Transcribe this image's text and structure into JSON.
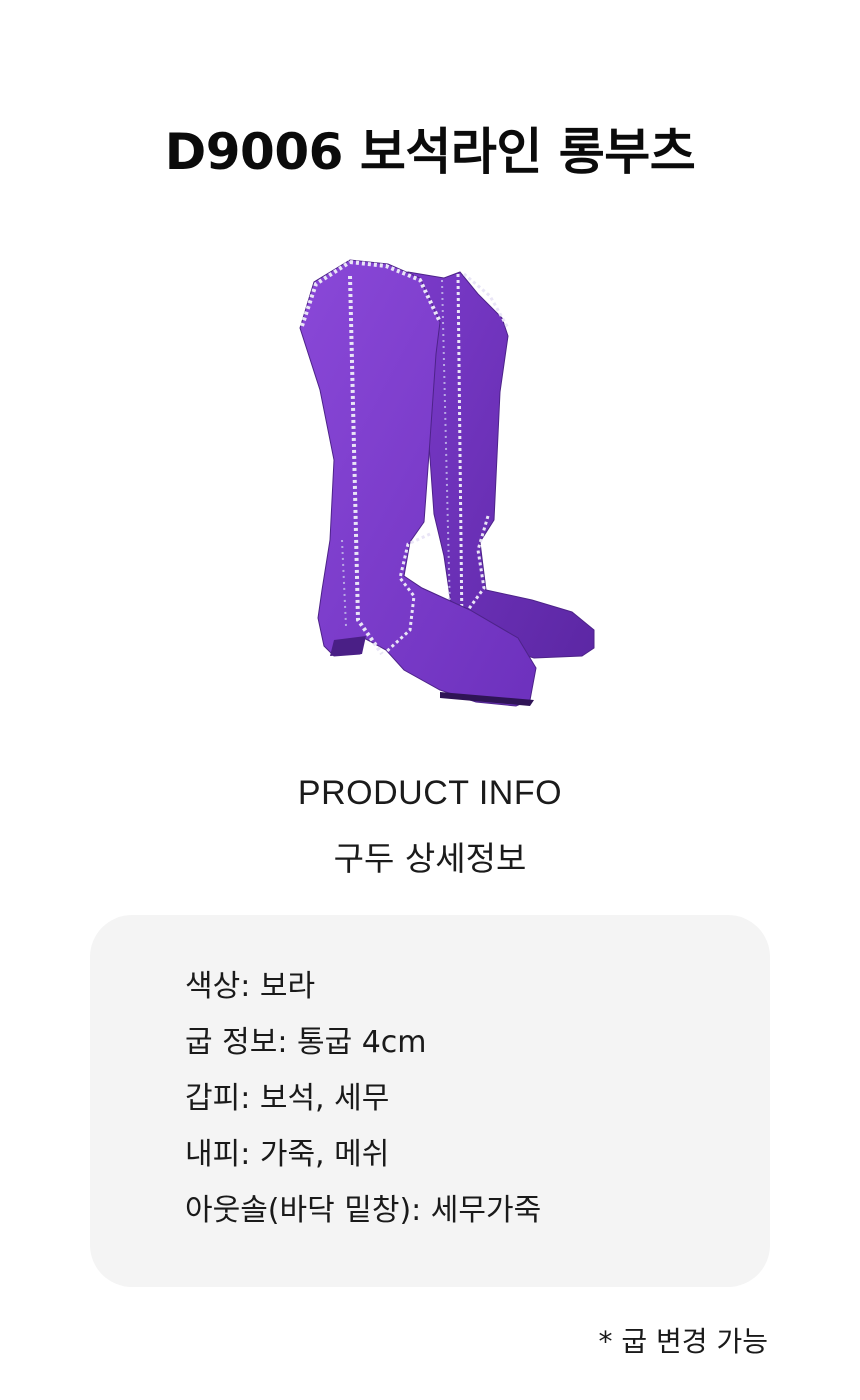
{
  "title": "D9006 보석라인 롱부츠",
  "product_image": {
    "icon": "purple-suede-long-boots-with-rhinestone-lines"
  },
  "info_heading": {
    "en": "PRODUCT INFO",
    "ko": "구두 상세정보"
  },
  "specs": [
    "색상: 보라",
    "굽 정보: 통굽 4cm",
    "갑피: 보석, 세무",
    "내피: 가죽, 메쉬",
    "아웃솔(바닥 밑창): 세무가죽"
  ],
  "note": "* 굽 변경 가능",
  "colors": {
    "boot_purple": "#7b3ec9",
    "boot_shadow": "#5e2aa6",
    "rhinestone": "#e9e5f6",
    "card_bg": "#f4f4f4"
  }
}
